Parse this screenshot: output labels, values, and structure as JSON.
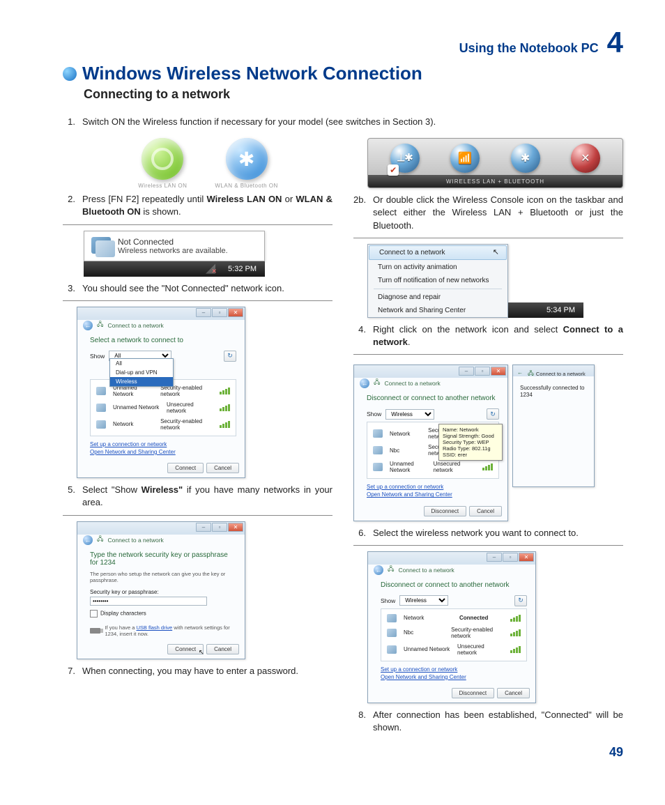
{
  "header": {
    "section": "Using the Notebook PC",
    "chapter": "4"
  },
  "title": "Windows Wireless Network Connection",
  "subtitle": "Connecting to a network",
  "step1": "Switch ON the Wireless function if necessary for your model (see switches in Section 3).",
  "badges": {
    "left": "Wireless LAN ON",
    "right": "WLAN & Bluetooth ON"
  },
  "banner_label": "WIRELESS LAN + BLUETOOTH",
  "step2_pre": "Press [FN F2] repeatedly until ",
  "step2_bold1": "Wireless LAN ON",
  "step2_mid": " or ",
  "step2_bold2": "WLAN & Bluetooth ON",
  "step2_post": " is shown.",
  "step2b": "Or double click the Wireless Console icon on the taskbar and select either the Wireless LAN + Bluetooth or just the Bluetooth.",
  "tooltip": {
    "title": "Not Connected",
    "body": "Wireless networks are available."
  },
  "time1": "5:32 PM",
  "time2": "5:34 PM",
  "menu": {
    "m1": "Connect to a network",
    "m2": "Turn on activity animation",
    "m3": "Turn off notification of new networks",
    "m4": "Diagnose and repair",
    "m5": "Network and Sharing Center"
  },
  "step3": "You should see the \"Not Connected\" network icon.",
  "step4_pre": "Right click on the network icon and select ",
  "step4_bold": "Connect to a network",
  "step4_post": ".",
  "win_common": {
    "nav": "Connect to a network",
    "show": "Show",
    "refresh": "↻",
    "link1": "Set up a connection or network",
    "link2": "Open Network and Sharing Center",
    "connect": "Connect",
    "cancel": "Cancel",
    "disconnect": "Disconnect"
  },
  "win5": {
    "heading": "Select a network to connect to",
    "show_val": "All",
    "dd1": "All",
    "dd2": "Dial-up and VPN",
    "dd3": "Wireless",
    "r1a": "Unnamed Network",
    "r1b": "Security-enabled network",
    "r2a": "Unnamed Network",
    "r2b": "Unsecured network",
    "r3a": "Network",
    "r3b": "Security-enabled network"
  },
  "win6": {
    "heading": "Disconnect or connect to another network",
    "show_val": "Wireless",
    "r1a": "Network",
    "r1b": "Security-enabled network",
    "r2a": "Nbc",
    "r2b": "Security-enabled network",
    "r3a": "Unnamed Network",
    "r3b": "Unsecured network",
    "tip1": "Name: Network",
    "tip2": "Signal Strength: Good",
    "tip3": "Security Type: WEP",
    "tip4": "Radio Type: 802.11g",
    "tip5": "SSID: erer"
  },
  "side_note": "Successfully connected to 1234",
  "step5_pre": "Select \"Show ",
  "step5_bold": "Wireless\"",
  "step5_post": " if you have many networks in your area.",
  "step6": "Select the wireless network you want to connect to.",
  "win7": {
    "heading": "Type the network security key or passphrase for 1234",
    "sub": "The person who setup the network can give you the key or passphrase.",
    "label": "Security key or passphrase:",
    "val": "••••••••",
    "check": "Display characters",
    "usb_pre": "If you have a ",
    "usb_link": "USB flash drive",
    "usb_post": " with network settings for 1234, insert it now."
  },
  "win8": {
    "heading": "Disconnect or connect to another network",
    "show_val": "Wireless",
    "r1a": "Network",
    "r1b": "Connected",
    "r2a": "Nbc",
    "r2b": "Security-enabled network",
    "r3a": "Unnamed Network",
    "r3b": "Unsecured network"
  },
  "step7": "When connecting, you may have to enter a password.",
  "step8": "After connection has been established, \"Connected\" will be shown.",
  "page": "49"
}
